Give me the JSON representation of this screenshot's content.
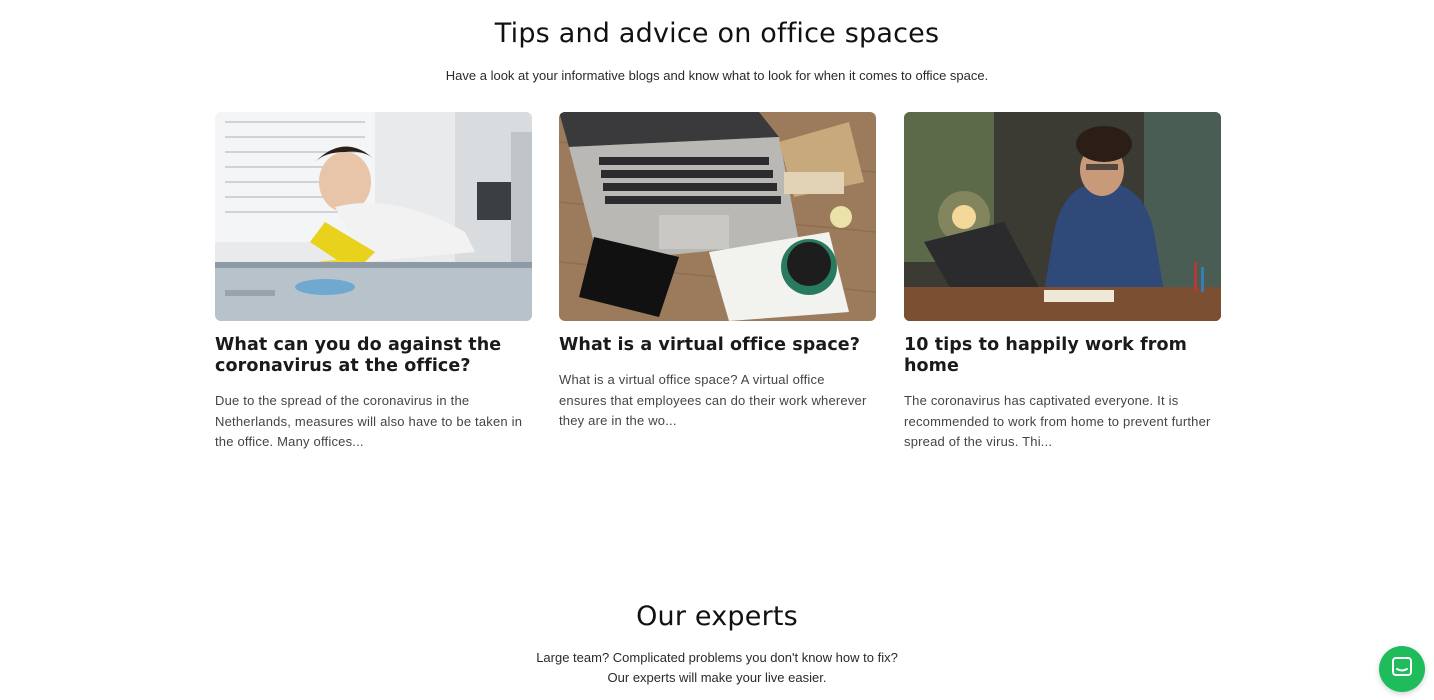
{
  "tips": {
    "title": "Tips and advice on office spaces",
    "subtitle": "Have a look at your informative blogs and know what to look for when it comes to office space."
  },
  "posts": [
    {
      "title": "What can you do against the coronavirus at the office?",
      "excerpt": "Due to the spread of the coronavirus in the Netherlands, measures will also have to be taken in the office. Many offices...",
      "image": "cleaning-office-photo"
    },
    {
      "title": "What is a virtual office space?",
      "excerpt": "What is a virtual office space? A virtual office ensures that employees can do their work wherever they are in the wo...",
      "image": "laptop-desk-photo"
    },
    {
      "title": "10 tips to happily work from home",
      "excerpt": "The coronavirus has captivated everyone. It is recommended to work from home to prevent further spread of the virus. Thi...",
      "image": "home-office-photo"
    }
  ],
  "experts": {
    "title": "Our experts",
    "subtitle_line1": "Large team? Complicated problems you don't know how to fix?",
    "subtitle_line2": "Our experts will make your live easier."
  },
  "chat": {
    "icon": "chat-icon",
    "color": "#1fbc5c"
  }
}
